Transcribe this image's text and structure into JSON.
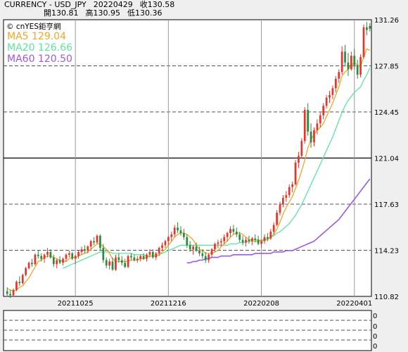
{
  "header": {
    "symbol": "CURRENCY - USD_JPY",
    "date": "20220429",
    "close_label": "收130.58",
    "open_label": "開130.81",
    "high_label": "高130.95",
    "low_label": "低130.36"
  },
  "chart_data": {
    "type": "candlestick",
    "watermark": "© cnYES鉅亨網",
    "legend": [
      {
        "name": "MA5",
        "value": "129.04",
        "color": "#f5a623"
      },
      {
        "name": "MA20",
        "value": "126.66",
        "color": "#5ee6a0"
      },
      {
        "name": "MA60",
        "value": "120.50",
        "color": "#9b59e6"
      }
    ],
    "ylim": [
      110.82,
      131.26
    ],
    "y_ticks": [
      "131.26",
      "127.85",
      "124.45",
      "121.04",
      "117.63",
      "114.23",
      "110.82"
    ],
    "x_ticks": [
      "20211025",
      "20211216",
      "20220208",
      "20220401"
    ],
    "grid": true,
    "up_color": "#e8352b",
    "down_color": "#2e8b3e",
    "candles": [
      [
        111.2,
        111.5,
        110.8,
        111.0
      ],
      [
        111.0,
        111.3,
        110.7,
        110.9
      ],
      [
        110.9,
        111.4,
        110.8,
        111.3
      ],
      [
        111.3,
        112.0,
        111.2,
        111.9
      ],
      [
        111.9,
        112.3,
        111.6,
        111.8
      ],
      [
        111.8,
        112.5,
        111.7,
        112.4
      ],
      [
        112.4,
        113.0,
        112.3,
        112.9
      ],
      [
        112.9,
        113.4,
        112.8,
        113.3
      ],
      [
        113.3,
        113.6,
        113.0,
        113.2
      ],
      [
        113.2,
        114.0,
        113.1,
        113.9
      ],
      [
        113.9,
        114.2,
        113.6,
        113.8
      ],
      [
        113.8,
        114.0,
        113.4,
        113.6
      ],
      [
        113.6,
        114.0,
        113.3,
        113.9
      ],
      [
        113.9,
        114.4,
        113.7,
        114.1
      ],
      [
        114.1,
        114.3,
        113.6,
        113.7
      ],
      [
        113.7,
        113.9,
        113.0,
        113.2
      ],
      [
        113.2,
        113.6,
        112.9,
        113.5
      ],
      [
        113.5,
        113.8,
        113.2,
        113.3
      ],
      [
        113.3,
        113.7,
        113.1,
        113.6
      ],
      [
        113.6,
        114.0,
        113.4,
        113.9
      ],
      [
        113.9,
        114.2,
        113.7,
        114.0
      ],
      [
        114.0,
        114.1,
        113.5,
        113.6
      ],
      [
        113.6,
        113.9,
        113.2,
        113.8
      ],
      [
        113.8,
        114.2,
        113.6,
        114.1
      ],
      [
        114.1,
        114.5,
        113.9,
        114.3
      ],
      [
        114.3,
        114.6,
        114.0,
        114.2
      ],
      [
        114.2,
        114.6,
        114.0,
        114.5
      ],
      [
        114.5,
        115.0,
        114.3,
        114.9
      ],
      [
        114.9,
        115.2,
        114.6,
        114.8
      ],
      [
        114.8,
        115.4,
        114.7,
        115.3
      ],
      [
        115.3,
        115.4,
        114.2,
        114.4
      ],
      [
        114.4,
        114.7,
        113.3,
        113.5
      ],
      [
        113.5,
        113.7,
        112.9,
        113.1
      ],
      [
        113.1,
        113.6,
        112.8,
        113.4
      ],
      [
        113.4,
        113.7,
        112.7,
        112.8
      ],
      [
        112.8,
        113.9,
        112.7,
        113.7
      ],
      [
        113.7,
        114.0,
        113.3,
        113.5
      ],
      [
        113.5,
        113.8,
        113.1,
        113.3
      ],
      [
        113.3,
        113.6,
        112.9,
        113.0
      ],
      [
        113.0,
        113.9,
        112.9,
        113.8
      ],
      [
        113.8,
        114.0,
        113.5,
        113.7
      ],
      [
        113.7,
        113.9,
        113.4,
        113.5
      ],
      [
        113.5,
        113.8,
        113.3,
        113.6
      ],
      [
        113.6,
        113.9,
        113.4,
        113.8
      ],
      [
        113.8,
        114.0,
        113.5,
        113.6
      ],
      [
        113.6,
        114.0,
        113.4,
        113.9
      ],
      [
        113.9,
        114.3,
        113.7,
        114.1
      ],
      [
        114.1,
        114.3,
        113.6,
        113.7
      ],
      [
        113.7,
        114.1,
        113.5,
        114.0
      ],
      [
        114.0,
        114.5,
        113.8,
        114.4
      ],
      [
        114.4,
        114.8,
        114.2,
        114.6
      ],
      [
        114.6,
        115.0,
        114.4,
        114.9
      ],
      [
        114.9,
        115.3,
        114.6,
        115.2
      ],
      [
        115.2,
        115.6,
        114.9,
        115.4
      ],
      [
        115.4,
        116.1,
        115.2,
        115.9
      ],
      [
        115.9,
        116.3,
        115.5,
        115.7
      ],
      [
        115.7,
        116.0,
        115.3,
        115.5
      ],
      [
        115.5,
        115.8,
        115.0,
        115.2
      ],
      [
        115.2,
        115.4,
        114.4,
        114.6
      ],
      [
        114.6,
        114.9,
        114.1,
        114.3
      ],
      [
        114.3,
        114.6,
        113.9,
        114.5
      ],
      [
        114.5,
        114.8,
        114.1,
        114.2
      ],
      [
        114.2,
        114.5,
        113.8,
        114.0
      ],
      [
        114.0,
        114.3,
        113.6,
        113.8
      ],
      [
        113.8,
        114.1,
        113.3,
        113.5
      ],
      [
        113.5,
        114.0,
        113.3,
        113.9
      ],
      [
        113.9,
        114.4,
        113.7,
        114.3
      ],
      [
        114.3,
        114.8,
        114.1,
        114.7
      ],
      [
        114.7,
        115.0,
        114.4,
        114.8
      ],
      [
        114.8,
        115.1,
        114.5,
        114.9
      ],
      [
        114.9,
        115.4,
        114.7,
        115.2
      ],
      [
        115.2,
        115.6,
        114.9,
        115.5
      ],
      [
        115.5,
        116.0,
        115.2,
        115.8
      ],
      [
        115.8,
        116.1,
        115.4,
        115.6
      ],
      [
        115.6,
        115.9,
        115.2,
        115.4
      ],
      [
        115.4,
        115.6,
        114.8,
        115.0
      ],
      [
        115.0,
        115.3,
        114.6,
        114.8
      ],
      [
        114.8,
        115.2,
        114.5,
        115.0
      ],
      [
        115.0,
        115.3,
        114.7,
        114.9
      ],
      [
        114.9,
        115.2,
        114.6,
        115.1
      ],
      [
        115.1,
        115.4,
        114.8,
        115.0
      ],
      [
        115.0,
        115.3,
        114.6,
        114.7
      ],
      [
        114.7,
        115.0,
        114.4,
        114.9
      ],
      [
        114.9,
        115.4,
        114.7,
        115.2
      ],
      [
        115.2,
        115.5,
        114.9,
        115.1
      ],
      [
        115.1,
        115.8,
        115.0,
        115.6
      ],
      [
        115.6,
        116.3,
        115.4,
        116.1
      ],
      [
        116.1,
        117.2,
        116.0,
        117.0
      ],
      [
        117.0,
        117.8,
        116.8,
        117.6
      ],
      [
        117.6,
        118.3,
        117.4,
        118.1
      ],
      [
        118.1,
        118.6,
        117.8,
        118.3
      ],
      [
        118.3,
        119.1,
        118.1,
        118.9
      ],
      [
        118.9,
        119.3,
        118.5,
        119.1
      ],
      [
        119.1,
        120.9,
        119.0,
        120.7
      ],
      [
        120.7,
        121.5,
        120.3,
        121.2
      ],
      [
        121.2,
        122.5,
        121.0,
        122.3
      ],
      [
        122.3,
        124.8,
        122.1,
        124.6
      ],
      [
        124.6,
        125.1,
        122.7,
        123.0
      ],
      [
        123.0,
        123.6,
        121.8,
        122.2
      ],
      [
        122.2,
        123.3,
        121.9,
        123.1
      ],
      [
        123.1,
        123.9,
        122.8,
        123.6
      ],
      [
        123.6,
        124.4,
        123.3,
        124.2
      ],
      [
        124.2,
        125.1,
        123.9,
        124.9
      ],
      [
        124.9,
        125.7,
        124.7,
        125.5
      ],
      [
        125.5,
        126.0,
        125.1,
        125.7
      ],
      [
        125.7,
        126.4,
        125.4,
        126.2
      ],
      [
        126.2,
        127.1,
        125.9,
        126.9
      ],
      [
        126.9,
        127.6,
        126.6,
        127.4
      ],
      [
        127.4,
        129.3,
        127.2,
        128.9
      ],
      [
        128.9,
        129.4,
        127.8,
        128.1
      ],
      [
        128.1,
        128.8,
        127.1,
        127.6
      ],
      [
        127.6,
        128.9,
        127.5,
        128.6
      ],
      [
        128.6,
        129.1,
        127.6,
        127.9
      ],
      [
        127.9,
        128.3,
        126.9,
        127.2
      ],
      [
        127.2,
        128.7,
        127.0,
        128.5
      ],
      [
        128.5,
        130.9,
        128.4,
        130.7
      ],
      [
        130.7,
        131.1,
        130.1,
        130.5
      ],
      [
        130.8,
        131.0,
        130.4,
        130.6
      ]
    ],
    "ma5": [
      111.4,
      111.3,
      111.2,
      111.3,
      111.5,
      111.6,
      111.9,
      112.2,
      112.6,
      113.0,
      113.4,
      113.5,
      113.7,
      113.8,
      113.8,
      113.7,
      113.6,
      113.5,
      113.4,
      113.4,
      113.6,
      113.7,
      113.7,
      113.8,
      113.9,
      114.0,
      114.1,
      114.3,
      114.5,
      114.7,
      114.7,
      114.5,
      114.3,
      114.0,
      113.6,
      113.4,
      113.4,
      113.4,
      113.4,
      113.4,
      113.5,
      113.5,
      113.5,
      113.6,
      113.6,
      113.7,
      113.8,
      113.8,
      113.8,
      113.9,
      114.1,
      114.3,
      114.6,
      114.9,
      115.2,
      115.4,
      115.5,
      115.5,
      115.4,
      115.2,
      115.0,
      114.6,
      114.3,
      114.2,
      114.0,
      114.0,
      114.0,
      114.1,
      114.2,
      114.5,
      114.7,
      114.9,
      115.2,
      115.4,
      115.5,
      115.5,
      115.4,
      115.2,
      115.0,
      115.0,
      115.0,
      115.0,
      114.9,
      115.0,
      115.0,
      115.2,
      115.4,
      115.8,
      116.3,
      116.9,
      117.4,
      117.8,
      118.2,
      118.8,
      119.4,
      120.1,
      120.9,
      121.8,
      122.4,
      122.8,
      123.1,
      123.3,
      123.6,
      124.1,
      124.6,
      125.1,
      125.7,
      126.3,
      127.1,
      127.4,
      127.6,
      127.9,
      128.1,
      127.9,
      127.8,
      128.5,
      129.1,
      129.0
    ],
    "ma20": [
      null,
      null,
      null,
      null,
      null,
      null,
      null,
      null,
      null,
      null,
      null,
      null,
      null,
      null,
      null,
      null,
      null,
      null,
      112.9,
      113.0,
      113.1,
      113.2,
      113.3,
      113.4,
      113.5,
      113.6,
      113.7,
      113.8,
      113.9,
      114.0,
      114.1,
      114.1,
      114.1,
      114.1,
      114.0,
      114.0,
      114.0,
      114.0,
      114.0,
      114.0,
      114.0,
      113.9,
      113.9,
      113.9,
      113.9,
      113.8,
      113.8,
      113.8,
      113.8,
      113.9,
      114.0,
      114.1,
      114.2,
      114.3,
      114.4,
      114.5,
      114.6,
      114.6,
      114.6,
      114.6,
      114.6,
      114.6,
      114.6,
      114.6,
      114.6,
      114.6,
      114.6,
      114.6,
      114.6,
      114.6,
      114.6,
      114.6,
      114.7,
      114.7,
      114.7,
      114.8,
      114.8,
      114.8,
      114.9,
      114.9,
      114.9,
      114.9,
      115.0,
      115.0,
      115.1,
      115.2,
      115.3,
      115.5,
      115.6,
      115.8,
      116.0,
      116.2,
      116.5,
      116.8,
      117.2,
      117.6,
      118.1,
      118.6,
      119.1,
      119.6,
      120.1,
      120.6,
      121.1,
      121.6,
      122.1,
      122.6,
      123.2,
      123.8,
      124.4,
      124.9,
      125.3,
      125.6,
      125.9,
      126.1,
      126.3,
      126.8,
      127.2,
      127.7
    ],
    "ma60": [
      null,
      null,
      null,
      null,
      null,
      null,
      null,
      null,
      null,
      null,
      null,
      null,
      null,
      null,
      null,
      null,
      null,
      null,
      null,
      null,
      null,
      null,
      null,
      null,
      null,
      null,
      null,
      null,
      null,
      null,
      null,
      null,
      null,
      null,
      null,
      null,
      null,
      null,
      null,
      null,
      null,
      null,
      null,
      null,
      null,
      null,
      null,
      null,
      null,
      null,
      null,
      null,
      null,
      null,
      null,
      null,
      null,
      null,
      113.3,
      113.3,
      113.4,
      113.4,
      113.5,
      113.5,
      113.6,
      113.6,
      113.7,
      113.7,
      113.7,
      113.8,
      113.8,
      113.8,
      113.8,
      113.9,
      113.9,
      113.9,
      113.9,
      113.9,
      113.9,
      113.9,
      114.0,
      114.0,
      114.0,
      114.0,
      114.0,
      114.0,
      114.1,
      114.1,
      114.1,
      114.1,
      114.2,
      114.2,
      114.2,
      114.3,
      114.4,
      114.5,
      114.6,
      114.7,
      114.8,
      114.9,
      115.1,
      115.3,
      115.5,
      115.7,
      115.9,
      116.1,
      116.3,
      116.5,
      116.8,
      117.1,
      117.4,
      117.7,
      118.0,
      118.3,
      118.6,
      118.9,
      119.2,
      119.5
    ]
  },
  "sub_chart": {
    "y_ticks": [
      "0",
      "0",
      "0",
      "0"
    ]
  }
}
